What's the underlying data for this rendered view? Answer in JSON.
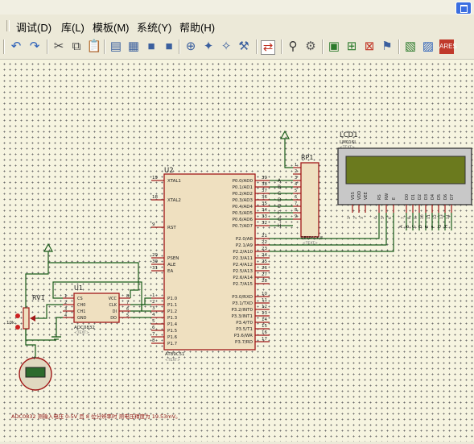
{
  "menu": {
    "items": [
      "调试(D)",
      "库(L)",
      "模板(M)",
      "系统(Y)",
      "帮助(H)"
    ]
  },
  "toolbar": {
    "icons": [
      "undo-icon",
      "redo-icon",
      "cut-icon",
      "copy-icon",
      "paste-icon",
      "align-icon",
      "pick-icon",
      "block-icon",
      "block2-icon",
      "zoom-icon",
      "wire-icon",
      "probe-icon",
      "tool-icon",
      "netlist-icon",
      "binoculars-icon",
      "wrench-icon",
      "sheet-icon",
      "add-sheet-icon",
      "delete-sheet-icon",
      "device-icon",
      "pcb-icon",
      "help-icon",
      "ares-icon"
    ]
  },
  "schematic": {
    "u2": {
      "ref": "U2",
      "part": "AT89C51",
      "text": "<TEXT>",
      "left_pins": [
        {
          "num": "19",
          "name": "XTAL1"
        },
        {
          "num": "18",
          "name": "XTAL2"
        },
        {
          "num": "9",
          "name": "RST"
        },
        {
          "num": "29",
          "name": "PSEN"
        },
        {
          "num": "30",
          "name": "ALE"
        },
        {
          "num": "31",
          "name": "EA"
        },
        {
          "num": "1",
          "name": "P1.0"
        },
        {
          "num": "2",
          "name": "P1.1"
        },
        {
          "num": "3",
          "name": "P1.2"
        },
        {
          "num": "4",
          "name": "P1.3"
        },
        {
          "num": "5",
          "name": "P1.4"
        },
        {
          "num": "6",
          "name": "P1.5"
        },
        {
          "num": "7",
          "name": "P1.6"
        },
        {
          "num": "8",
          "name": "P1.7"
        }
      ],
      "right_pins": [
        {
          "num": "39",
          "name": "P0.0/AD0"
        },
        {
          "num": "38",
          "name": "P0.1/AD1"
        },
        {
          "num": "37",
          "name": "P0.2/AD2"
        },
        {
          "num": "36",
          "name": "P0.3/AD3"
        },
        {
          "num": "35",
          "name": "P0.4/AD4"
        },
        {
          "num": "34",
          "name": "P0.5/AD5"
        },
        {
          "num": "33",
          "name": "P0.6/AD6"
        },
        {
          "num": "32",
          "name": "P0.7/AD7"
        },
        {
          "num": "21",
          "name": "P2.0/A8"
        },
        {
          "num": "22",
          "name": "P2.1/A9"
        },
        {
          "num": "23",
          "name": "P2.2/A10"
        },
        {
          "num": "24",
          "name": "P2.3/A11"
        },
        {
          "num": "25",
          "name": "P2.4/A12"
        },
        {
          "num": "26",
          "name": "P2.5/A13"
        },
        {
          "num": "27",
          "name": "P2.6/A14"
        },
        {
          "num": "28",
          "name": "P2.7/A15"
        },
        {
          "num": "10",
          "name": "P3.0/RXD"
        },
        {
          "num": "11",
          "name": "P3.1/TXD"
        },
        {
          "num": "12",
          "name": "P3.2/INT0"
        },
        {
          "num": "13",
          "name": "P3.3/INT1"
        },
        {
          "num": "14",
          "name": "P3.4/T0"
        },
        {
          "num": "15",
          "name": "P3.5/T1"
        },
        {
          "num": "16",
          "name": "P3.6/WR"
        },
        {
          "num": "17",
          "name": "P3.7/RD"
        }
      ]
    },
    "u1": {
      "ref": "U1",
      "part": "ADC0832",
      "text": "<TEXT>",
      "left_pins": [
        {
          "num": "1",
          "name": "CS"
        },
        {
          "num": "2",
          "name": "CH0"
        },
        {
          "num": "3",
          "name": "CH1"
        },
        {
          "num": "4",
          "name": "GND"
        }
      ],
      "right_pins": [
        {
          "num": "8",
          "name": "VCC"
        },
        {
          "num": "7",
          "name": "CLK"
        },
        {
          "num": "6",
          "name": "DI"
        },
        {
          "num": "5",
          "name": "DO"
        }
      ]
    },
    "rp1": {
      "ref": "RP1",
      "part": "RESPACK-8",
      "text": "<TEXT>",
      "pins": [
        "1",
        "2",
        "3",
        "4",
        "5",
        "6",
        "7",
        "8",
        "9"
      ]
    },
    "bus_labels": [
      "A",
      "B",
      "C",
      "D",
      "E",
      "F",
      "G",
      "H"
    ],
    "lcd": {
      "ref": "LCD1",
      "part": "LM016L",
      "text": "<TEXT>",
      "pin_names": [
        "VSS",
        "VDD",
        "VEE",
        "RS",
        "RW",
        "E",
        "D0",
        "D1",
        "D2",
        "D3",
        "D4",
        "D5",
        "D6",
        "D7"
      ],
      "pin_nums": [
        "1",
        "2",
        "3",
        "4",
        "5",
        "6",
        "7",
        "8",
        "9",
        "10",
        "11",
        "12",
        "13",
        "14"
      ],
      "bus_labels": [
        "A",
        "B",
        "C",
        "D",
        "E",
        "F",
        "G",
        "H"
      ]
    },
    "rv1": {
      "ref": "RV1",
      "value": "10k"
    },
    "caption": "ADC0832 测输入电压 0-5V 且 8 位分辨率时 测电压精度为 19.53mV。"
  }
}
